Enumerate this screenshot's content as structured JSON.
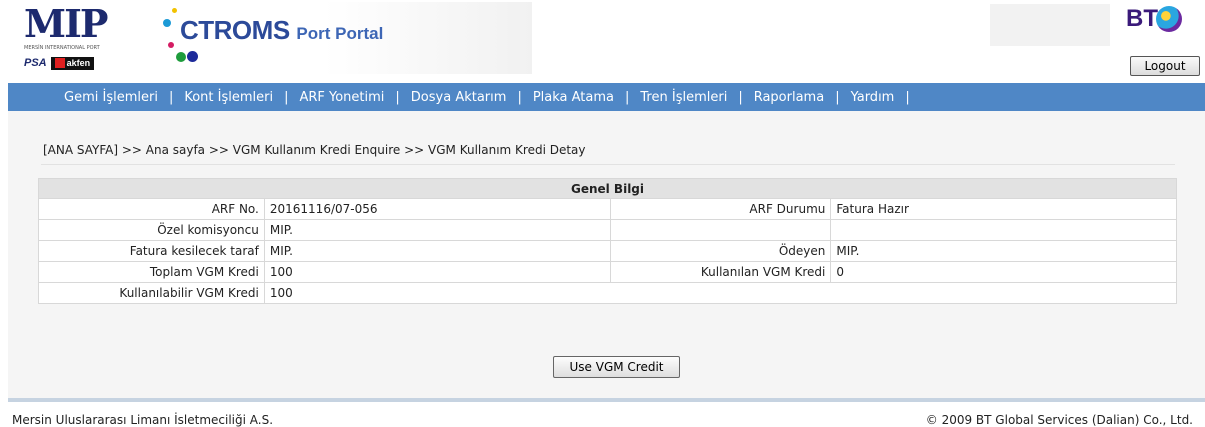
{
  "header": {
    "mip_logo_text": "MIP",
    "mip_subtitle": "MERSİN INTERNATIONAL PORT",
    "partner_psa": "PSA",
    "partner_akfen": "akfen",
    "portal_name": "CTROMS",
    "portal_suffix": "Port Portal",
    "bt_logo": "BT",
    "logout_label": "Logout"
  },
  "nav": {
    "items": [
      {
        "label": "Gemi İşlemleri"
      },
      {
        "label": "Kont İşlemleri"
      },
      {
        "label": "ARF Yonetimi"
      },
      {
        "label": "Dosya Aktarım"
      },
      {
        "label": "Plaka Atama"
      },
      {
        "label": "Tren İşlemleri"
      },
      {
        "label": "Raporlama"
      },
      {
        "label": "Yardım"
      }
    ],
    "separator": "|"
  },
  "breadcrumb": "[ANA SAYFA] >> Ana sayfa >> VGM Kullanım Kredi Enquire >> VGM Kullanım Kredi Detay",
  "info": {
    "title": "Genel Bilgi",
    "arf_no_label": "ARF No.",
    "arf_no": "20161116/07-056",
    "arf_durumu_label": "ARF Durumu",
    "arf_durumu": "Fatura Hazır",
    "ozel_komisyoncu_label": "Özel komisyoncu",
    "ozel_komisyoncu": "MIP.",
    "fatura_label": "Fatura kesilecek taraf",
    "fatura": "MIP.",
    "odeyen_label": "Ödeyen",
    "odeyen": "MIP.",
    "toplam_label": "Toplam VGM Kredi",
    "toplam": "100",
    "kullanilan_label": "Kullanılan VGM Kredi",
    "kullanilan": "0",
    "kullanilabilir_label": "Kullanılabilir VGM Kredi",
    "kullanilabilir": "100"
  },
  "actions": {
    "use_credit_label": "Use VGM Credit"
  },
  "footer": {
    "left": "Mersin Uluslararası Limanı İsletmeciliği A.S.",
    "right": "© 2009 BT Global Services (Dalian) Co., Ltd."
  },
  "colors": {
    "nav_bg": "#4f87c6",
    "content_bg": "#f5f5f5",
    "table_header_bg": "#e2e2e2",
    "footer_bar": "#c6d3e1"
  }
}
